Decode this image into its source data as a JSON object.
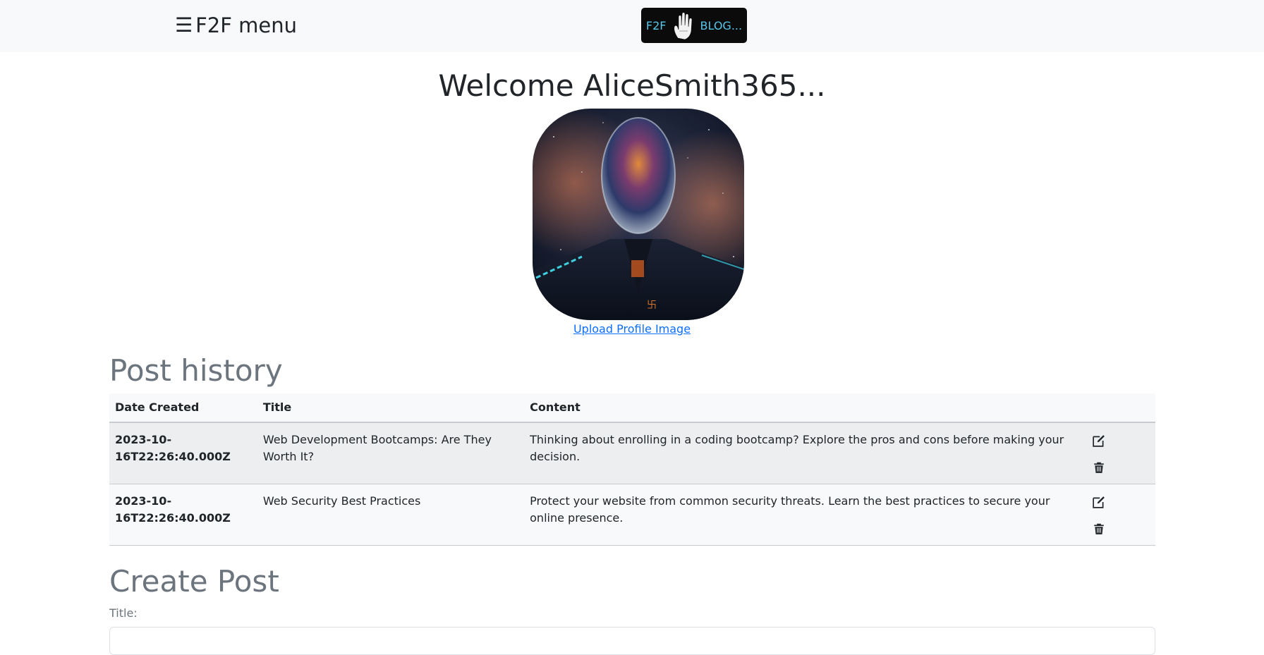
{
  "nav": {
    "menu_label": "F2F menu",
    "logo_left": "F2F",
    "logo_right": "BLOG..."
  },
  "profile": {
    "welcome": "Welcome AliceSmith365...",
    "upload_link": "Upload Profile Image"
  },
  "post_history": {
    "heading": "Post history",
    "columns": [
      "Date Created",
      "Title",
      "Content",
      ""
    ],
    "rows": [
      {
        "date": "2023-10-16T22:26:40.000Z",
        "title": "Web Development Bootcamps: Are They Worth It?",
        "content": "Thinking about enrolling in a coding bootcamp? Explore the pros and cons before making your decision."
      },
      {
        "date": "2023-10-16T22:26:40.000Z",
        "title": "Web Security Best Practices",
        "content": "Protect your website from common security threats. Learn the best practices to secure your online presence."
      }
    ]
  },
  "create_post": {
    "heading": "Create Post",
    "title_label": "Title:"
  },
  "icons": {
    "menu": "hamburger-icon",
    "edit": "edit-icon",
    "delete": "trash-icon"
  },
  "colors": {
    "navbar_bg": "#f8f9fa",
    "link": "#0d6efd",
    "muted_heading": "#6c757d",
    "logo_accent": "#56c6ea"
  }
}
